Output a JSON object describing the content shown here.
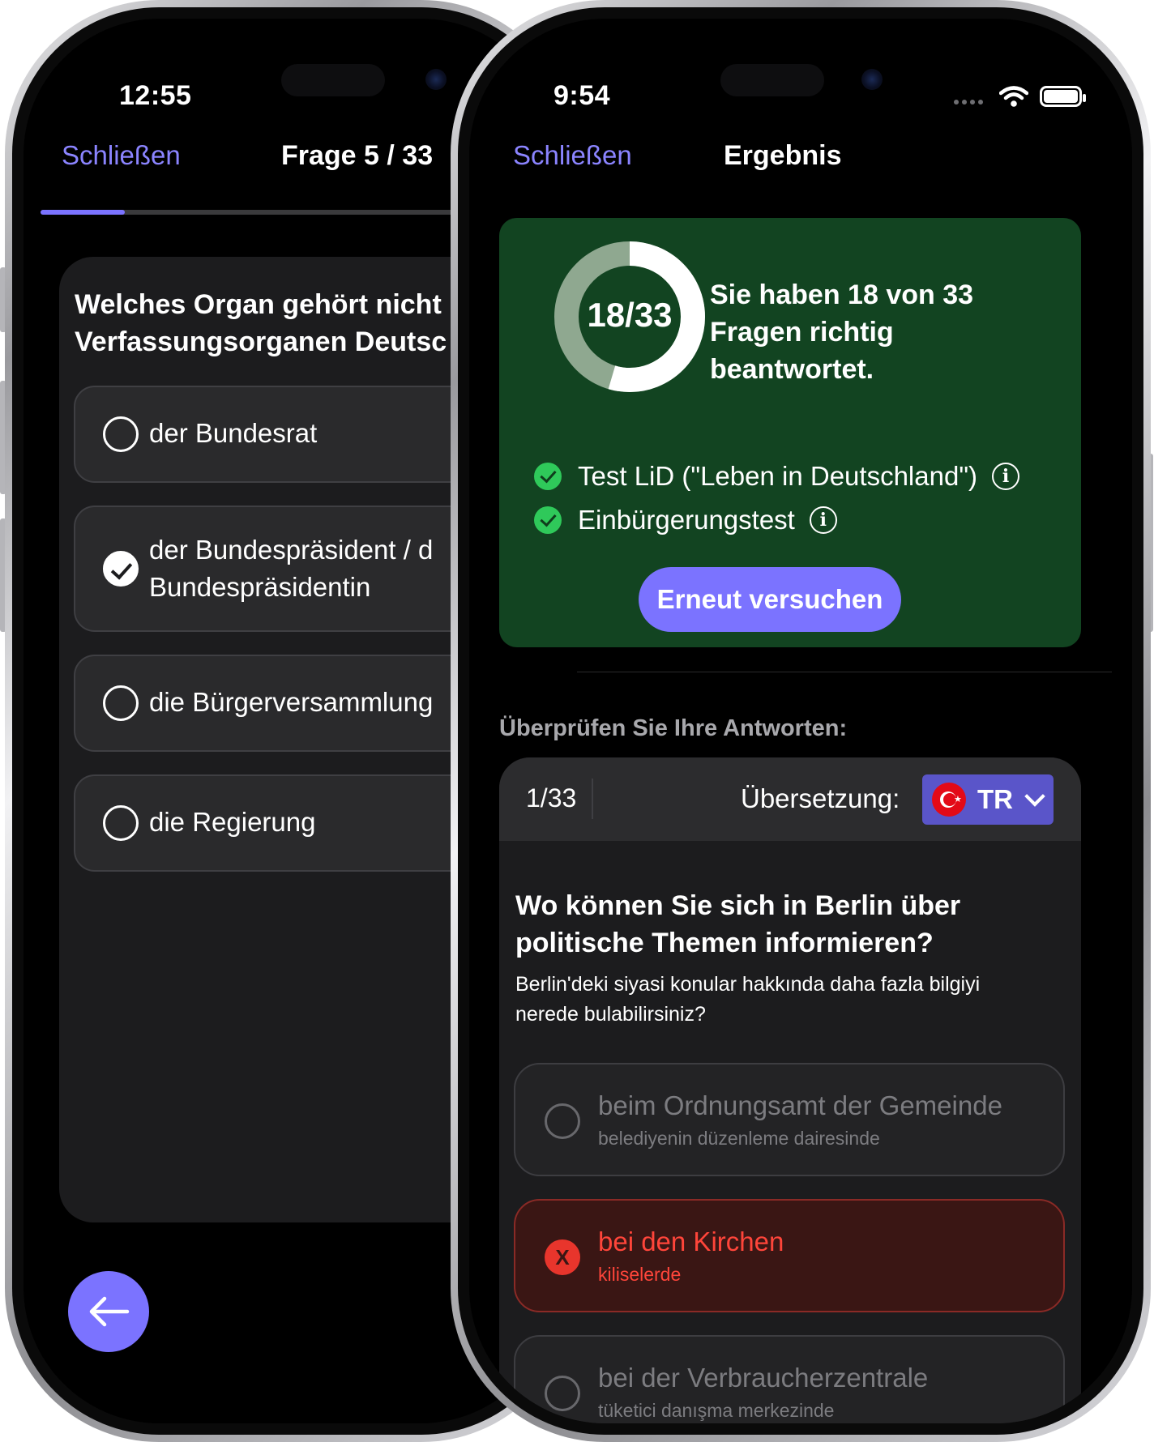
{
  "left_phone": {
    "status": {
      "time": "12:55"
    },
    "nav": {
      "close_label": "Schließen",
      "title": "Frage 5 / 33"
    },
    "progress_fraction": 0.2,
    "question": {
      "line1": "Welches Organ gehört nicht",
      "line2": "Verfassungsorganen Deutsc"
    },
    "options": [
      {
        "lines": [
          "der Bundesrat"
        ],
        "checked": false
      },
      {
        "lines": [
          "der Bundespräsident / d",
          "Bundespräsidentin"
        ],
        "checked": true
      },
      {
        "lines": [
          "die Bürgerversammlung"
        ],
        "checked": false
      },
      {
        "lines": [
          "die Regierung"
        ],
        "checked": false
      }
    ],
    "back_icon": "arrow-left-icon"
  },
  "right_phone": {
    "status": {
      "time": "9:54"
    },
    "nav": {
      "close_label": "Schließen",
      "title": "Ergebnis"
    },
    "result": {
      "score_label": "18/33",
      "score": 18,
      "total": 33,
      "line1": "Sie haben 18 von 33",
      "line2": "Fragen richtig",
      "line3": "beantwortet.",
      "tests": [
        {
          "label": "Test LiD (\"Leben in Deutschland\")"
        },
        {
          "label": "Einbürgerungstest"
        }
      ],
      "retry_label": "Erneut versuchen"
    },
    "review": {
      "heading": "Überprüfen Sie Ihre Antworten:",
      "counter": "1/33",
      "translation_label": "Übersetzung:",
      "language": "TR",
      "question_line1": "Wo können Sie sich in Berlin über",
      "question_line2": "politische Themen informieren?",
      "translation_line1": "Berlin'deki siyasi konular hakkında daha fazla bilgiyi",
      "translation_line2": "nerede bulabilirsiniz?",
      "answers": [
        {
          "text": "beim Ordnungsamt der Gemeinde",
          "translation": "belediyenin düzenleme dairesinde",
          "state": "neutral"
        },
        {
          "text": "bei den Kirchen",
          "translation": "kiliselerde",
          "state": "wrong",
          "mark": "X"
        },
        {
          "text": "bei der Verbraucherzentrale",
          "translation": "tüketici danışma merkezinde",
          "state": "neutral"
        }
      ]
    }
  },
  "colors": {
    "accent": "#7b73ff",
    "result_bg": "#124421",
    "success": "#2fc95a",
    "error": "#ff453a"
  }
}
